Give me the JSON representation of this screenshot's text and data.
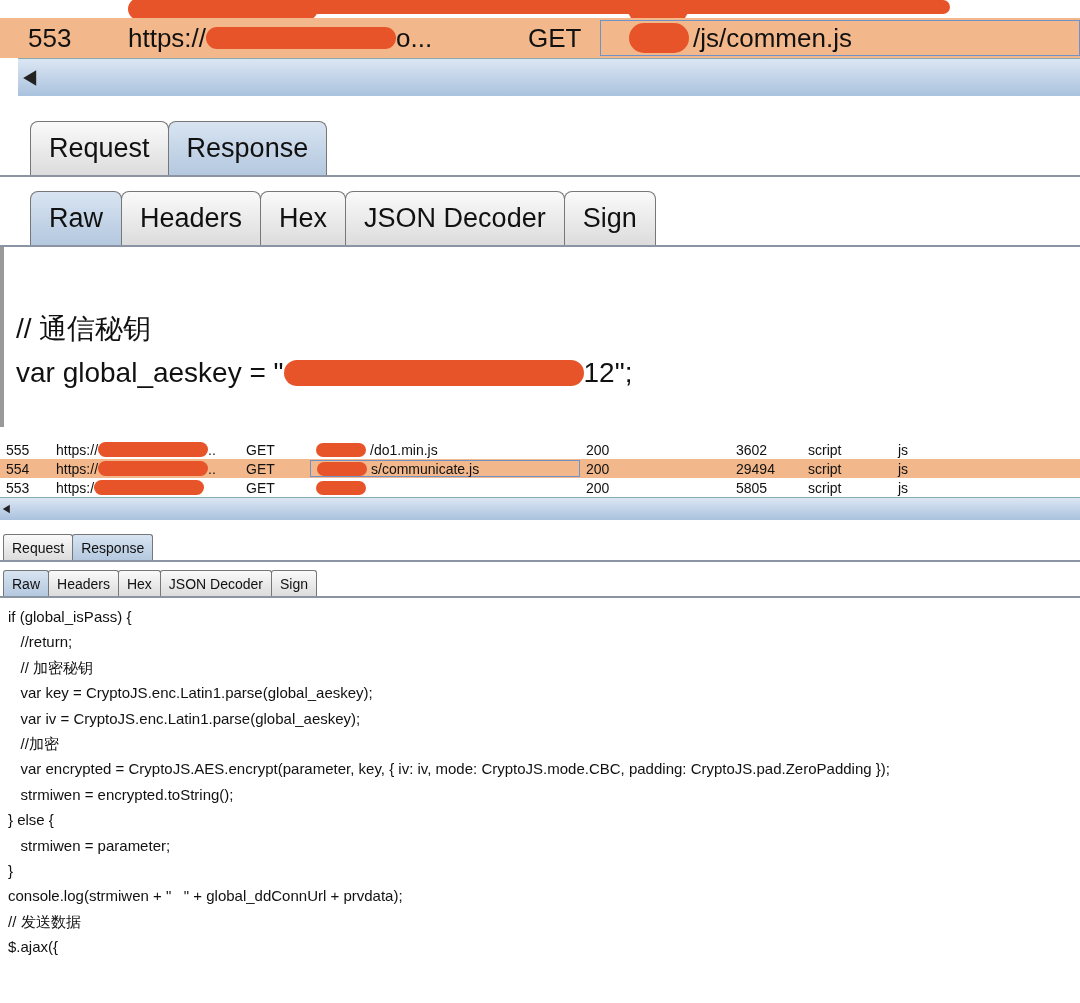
{
  "views": [
    {
      "rows": [
        {
          "selected": false
        },
        {
          "number": "553",
          "host": "https://",
          "host_suffix": "o...",
          "method": "GET",
          "path": "/js/commen.js",
          "selected": true
        }
      ],
      "tabs": [
        {
          "label": "Request",
          "selected": false
        },
        {
          "label": "Response",
          "selected": true
        }
      ],
      "subtabs": [
        {
          "label": "Raw",
          "selected": true
        },
        {
          "label": "Headers",
          "selected": false
        },
        {
          "label": "Hex",
          "selected": false
        },
        {
          "label": "JSON Decoder",
          "selected": false
        },
        {
          "label": "Sign",
          "selected": false
        }
      ],
      "code": [
        {
          "segments": [
            "// 通信秘钥"
          ]
        },
        {
          "segments": [
            "var global_aeskey = \"",
            "12\";"
          ]
        }
      ]
    },
    {
      "rows": [
        {
          "number": "555",
          "host": "https://",
          "host_suffix": "..",
          "method": "GET",
          "path": "/do1.min.js",
          "status": "200",
          "length": "3602",
          "mime": "script",
          "extension": "js",
          "selected": false
        },
        {
          "number": "554",
          "host": "https://",
          "host_suffix": "..",
          "method": "GET",
          "path": "s/communicate.js",
          "status": "200",
          "length": "29494",
          "mime": "script",
          "extension": "js",
          "selected": true
        },
        {
          "number": "553",
          "host": "https:/",
          "method": "GET",
          "status": "200",
          "length": "5805",
          "mime": "script",
          "extension": "js",
          "selected": false
        }
      ],
      "tabs": [
        {
          "label": "Request",
          "selected": false
        },
        {
          "label": "Response",
          "selected": true
        }
      ],
      "subtabs": [
        {
          "label": "Raw",
          "selected": true
        },
        {
          "label": "Headers",
          "selected": false
        },
        {
          "label": "Hex",
          "selected": false
        },
        {
          "label": "JSON Decoder",
          "selected": false
        },
        {
          "label": "Sign",
          "selected": false
        }
      ],
      "code": [
        {
          "segments": [
            "if (global_isPass) {"
          ]
        },
        {
          "segments": [
            "   //return;"
          ]
        },
        {
          "segments": [
            "   // 加密秘钥"
          ]
        },
        {
          "segments": [
            "   var key = CryptoJS.enc.Latin1.parse(global_aeskey);"
          ]
        },
        {
          "segments": [
            "   var iv = CryptoJS.enc.Latin1.parse(global_aeskey);"
          ]
        },
        {
          "segments": [
            "   //加密"
          ]
        },
        {
          "segments": [
            "   var encrypted = CryptoJS.AES.encrypt(parameter, key, { iv: iv, mode: CryptoJS.mode.CBC, padding: CryptoJS.pad.ZeroPadding });"
          ]
        },
        {
          "segments": [
            "   strmiwen = encrypted.toString();"
          ]
        },
        {
          "segments": [
            "} else {"
          ]
        },
        {
          "segments": [
            "   strmiwen = parameter;"
          ]
        },
        {
          "segments": [
            "}"
          ]
        },
        {
          "segments": [
            "console.log(strmiwen + \"   \" + global_ddConnUrl + prvdata);"
          ]
        },
        {
          "segments": [
            "// 发送数据"
          ]
        },
        {
          "segments": [
            "$.ajax({"
          ]
        }
      ]
    }
  ]
}
